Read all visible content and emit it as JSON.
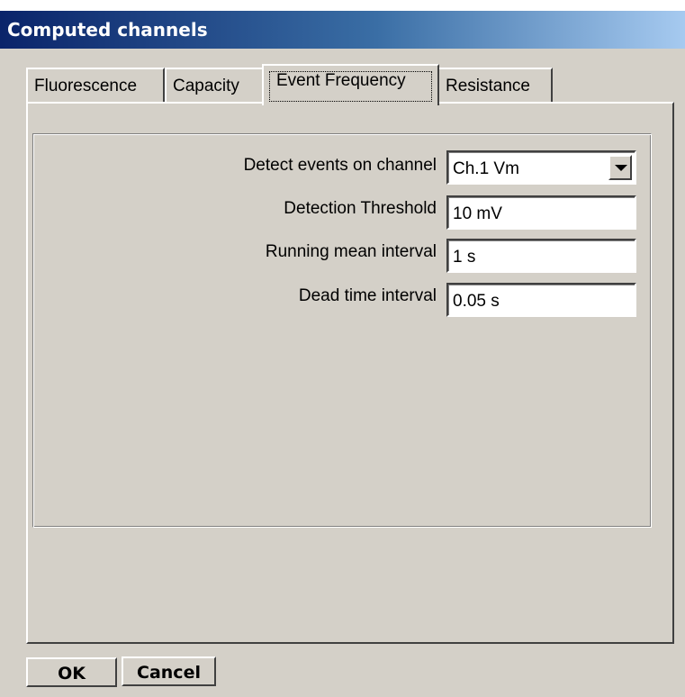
{
  "window": {
    "title": "Computed channels"
  },
  "tabs": [
    {
      "label": "Fluorescence"
    },
    {
      "label": "Capacity"
    },
    {
      "label": "Event Frequency",
      "active": true
    },
    {
      "label": "Resistance"
    }
  ],
  "fields": {
    "detect_channel": {
      "label": "Detect events on channel",
      "value": "Ch.1 Vm"
    },
    "threshold": {
      "label": "Detection Threshold",
      "value": "10 mV"
    },
    "running_mean": {
      "label": "Running mean interval",
      "value": "1 s"
    },
    "dead_time": {
      "label": "Dead time interval",
      "value": "0.05 s"
    }
  },
  "buttons": {
    "ok": "OK",
    "cancel": "Cancel"
  }
}
